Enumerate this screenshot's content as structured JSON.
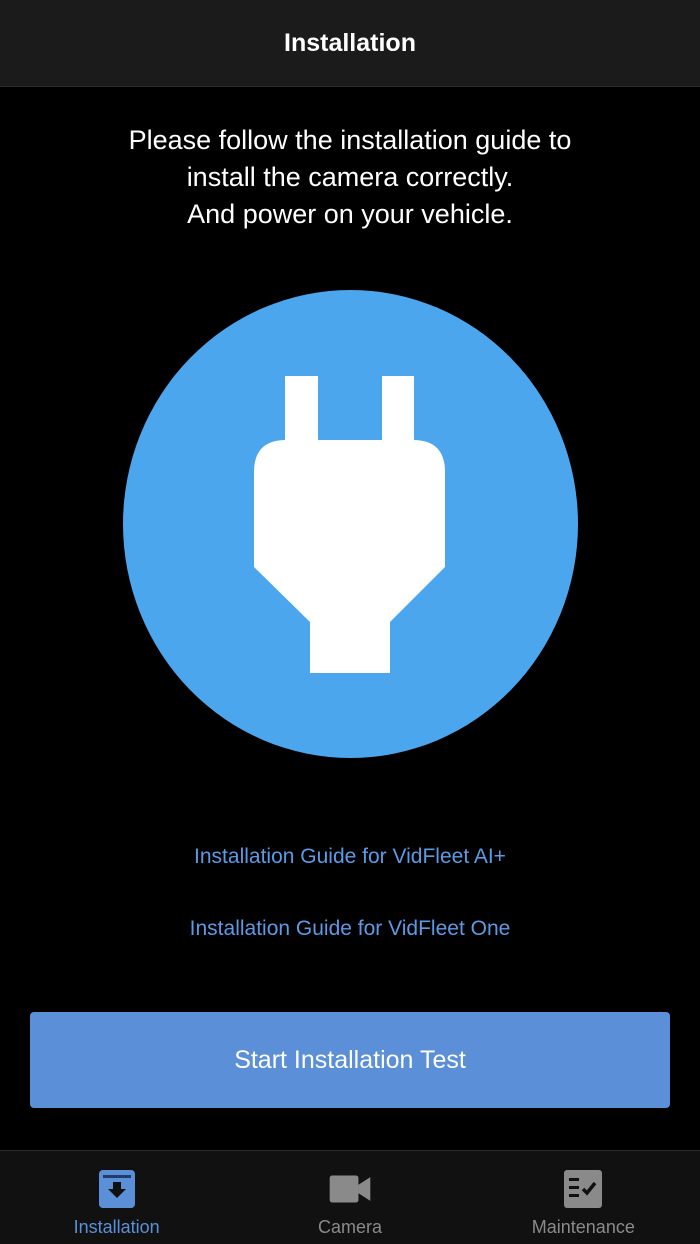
{
  "navbar": {
    "title": "Installation"
  },
  "instructions": {
    "lines": [
      "Please follow the installation guide to",
      "install the camera correctly.",
      "And power on your vehicle."
    ]
  },
  "illustration": {
    "icon": "plug-icon",
    "circle_color": "#4ba6ee"
  },
  "links": {
    "guide_ai_plus": "Installation Guide for VidFleet AI+",
    "guide_one": "Installation Guide for VidFleet One"
  },
  "actions": {
    "start_test": "Start Installation Test"
  },
  "tabs": [
    {
      "label": "Installation",
      "icon": "installation-icon",
      "active": true
    },
    {
      "label": "Camera",
      "icon": "video-camera-icon",
      "active": false
    },
    {
      "label": "Maintenance",
      "icon": "checklist-icon",
      "active": false
    }
  ],
  "colors": {
    "accent": "#5b8fd8",
    "link": "#5c9ae6",
    "inactive_tab": "#8a8a8a",
    "background": "#000000"
  }
}
